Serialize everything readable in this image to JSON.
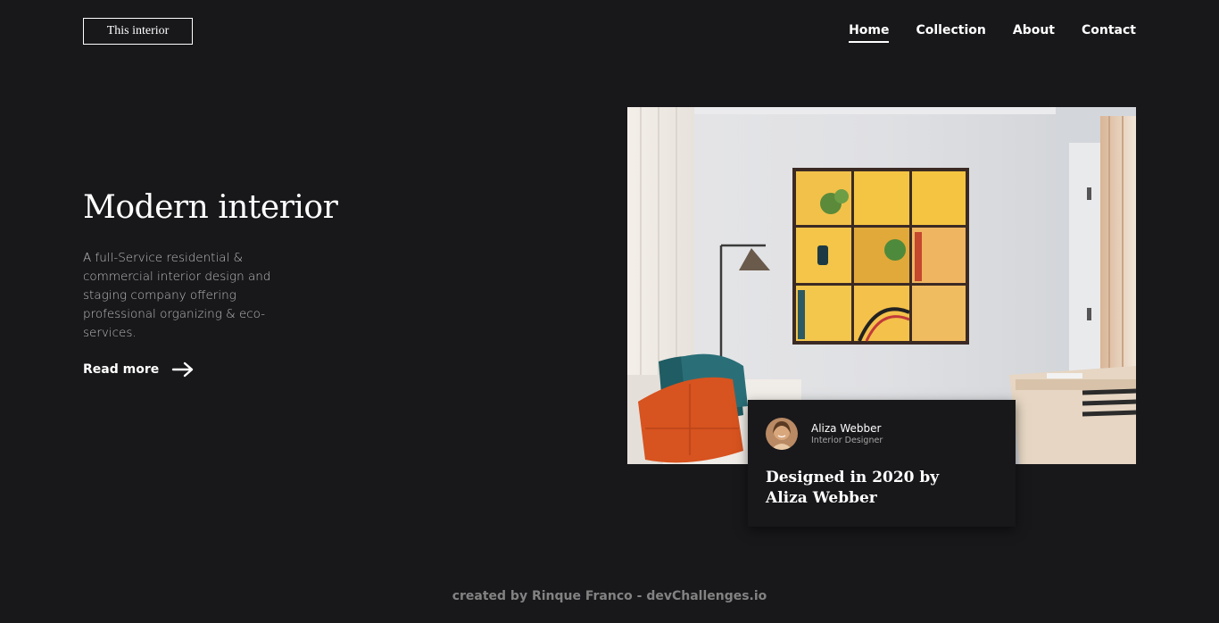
{
  "header": {
    "logo": "This interior",
    "nav": [
      {
        "label": "Home",
        "active": true
      },
      {
        "label": "Collection",
        "active": false
      },
      {
        "label": "About",
        "active": false
      },
      {
        "label": "Contact",
        "active": false
      }
    ]
  },
  "hero": {
    "title": "Modern interior",
    "description": "A full-Service residential & commercial interior design and staging company offering professional organizing & eco-services.",
    "cta": "Read more",
    "cta_icon": "arrow-right-icon"
  },
  "card": {
    "name": "Aliza Webber",
    "role": "Interior Designer",
    "title": "Designed in 2020 by Aliza Webber"
  },
  "footer": {
    "credit": "created by Rinque Franco - devChallenges.io"
  },
  "colors": {
    "background": "#18181b",
    "text": "#ffffff",
    "muted": "#bdbdbd",
    "footer": "#828282"
  }
}
